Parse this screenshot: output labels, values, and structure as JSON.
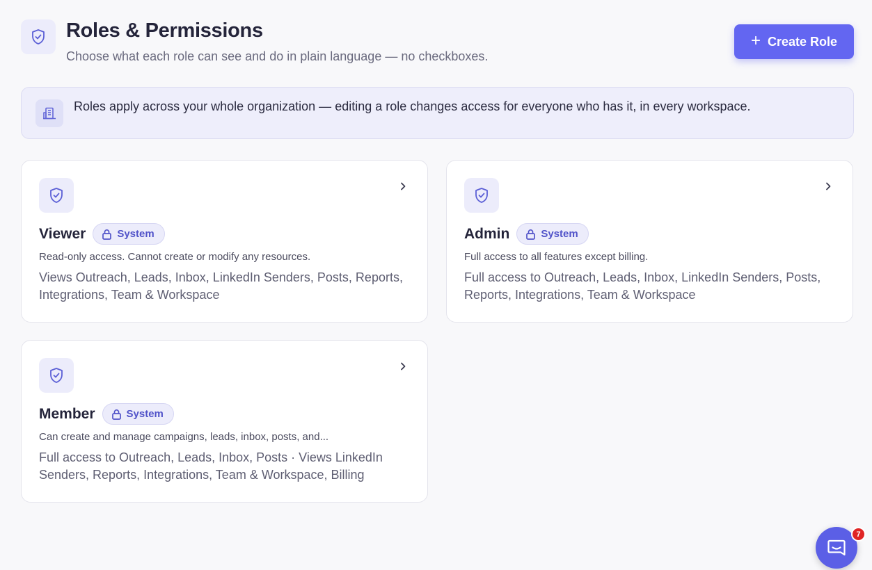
{
  "header": {
    "title": "Roles & Permissions",
    "subtitle": "Choose what each role can see and do in plain language — no checkboxes.",
    "icon": "shield-check-icon",
    "create_label": "Create Role"
  },
  "banner": {
    "icon": "building-icon",
    "text": "Roles apply across your whole organization — editing a role changes access for everyone who has it, in every workspace."
  },
  "roles": [
    {
      "name": "Viewer",
      "badge": "System",
      "description": "Read-only access. Cannot create or modify any resources.",
      "permissions": "Views Outreach, Leads, Inbox, LinkedIn Senders, Posts, Reports, Integrations, Team & Workspace"
    },
    {
      "name": "Admin",
      "badge": "System",
      "description": "Full access to all features except billing.",
      "permissions": "Full access to Outreach, Leads, Inbox, LinkedIn Senders, Posts, Reports, Integrations, Team & Workspace"
    },
    {
      "name": "Member",
      "badge": "System",
      "description": "Can create and manage campaigns, leads, inbox, posts, and...",
      "permissions": "Full access to Outreach, Leads, Inbox, Posts · Views LinkedIn Senders, Reports, Integrations, Team & Workspace, Billing"
    }
  ],
  "chat": {
    "unread_count": "7"
  },
  "colors": {
    "accent": "#6366f1",
    "badge_text": "#5153c9",
    "notification": "#e02424"
  }
}
